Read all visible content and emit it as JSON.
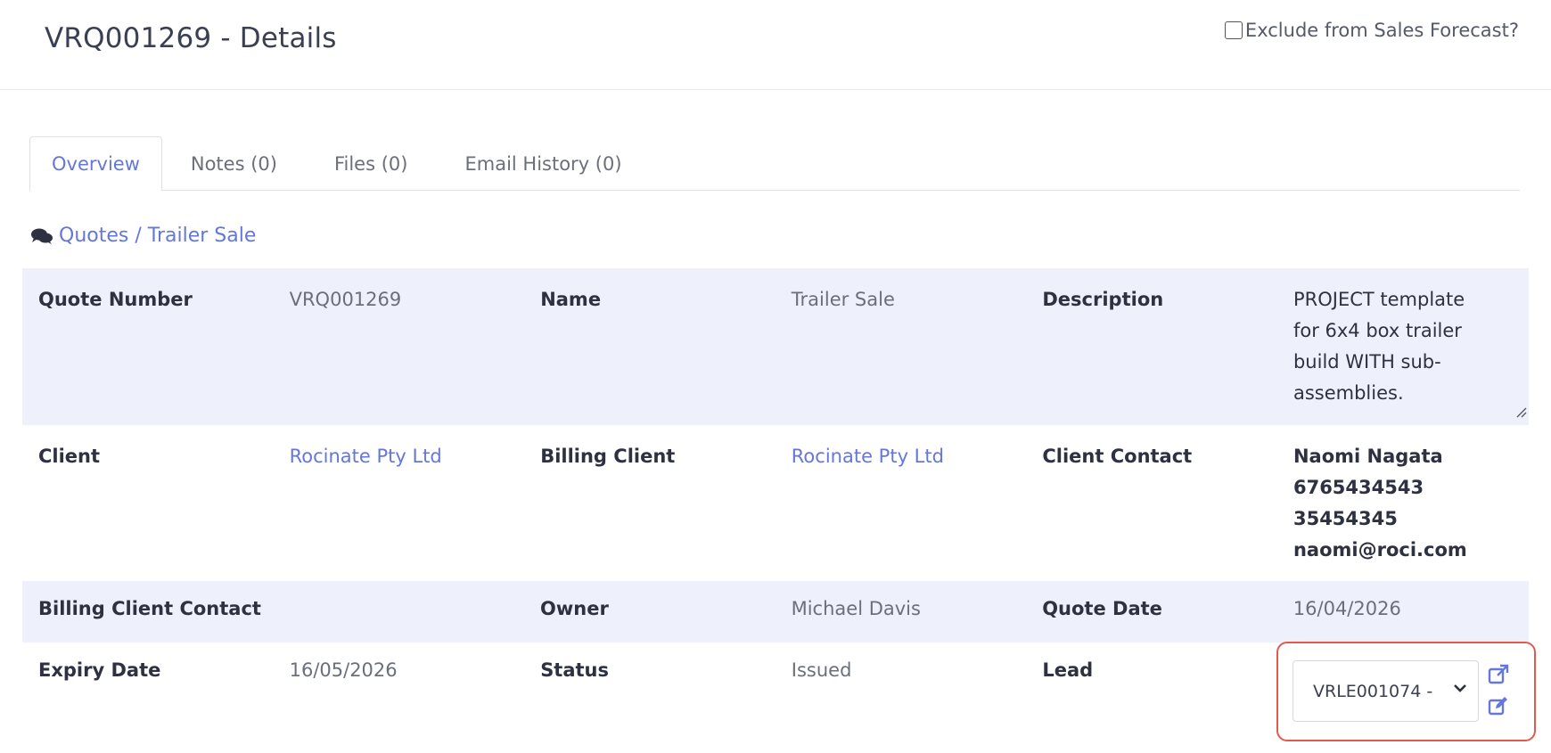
{
  "header": {
    "title": "VRQ001269 - Details",
    "exclude_label": "Exclude from Sales Forecast?",
    "exclude_checked": false
  },
  "tabs": [
    {
      "label": "Overview",
      "active": true
    },
    {
      "label": "Notes (0)",
      "active": false
    },
    {
      "label": "Files (0)",
      "active": false
    },
    {
      "label": "Email History (0)",
      "active": false
    }
  ],
  "breadcrumb": {
    "icon": "comments-icon",
    "label": "Quotes / Trailer Sale"
  },
  "details": {
    "quote_number_label": "Quote Number",
    "quote_number": "VRQ001269",
    "name_label": "Name",
    "name": "Trailer Sale",
    "description_label": "Description",
    "description": [
      "PROJECT template",
      "for 6x4 box trailer",
      "build WITH sub-",
      "assemblies."
    ],
    "client_label": "Client",
    "client": "Rocinate Pty Ltd",
    "billing_client_label": "Billing Client",
    "billing_client": "Rocinate Pty Ltd",
    "client_contact_label": "Client Contact",
    "client_contact": [
      "Naomi Nagata",
      "6765434543",
      "35454345",
      "naomi@roci.com"
    ],
    "billing_client_contact_label": "Billing Client Contact",
    "billing_client_contact": "",
    "owner_label": "Owner",
    "owner": "Michael Davis",
    "quote_date_label": "Quote Date",
    "quote_date": "16/04/2026",
    "expiry_date_label": "Expiry Date",
    "expiry_date": "16/05/2026",
    "status_label": "Status",
    "status": "Issued",
    "lead_label": "Lead",
    "lead_selected": "VRLE001074 -"
  },
  "colors": {
    "accent": "#6577d8",
    "row_shade": "#eef1fc",
    "highlight": "#e15a4e"
  }
}
